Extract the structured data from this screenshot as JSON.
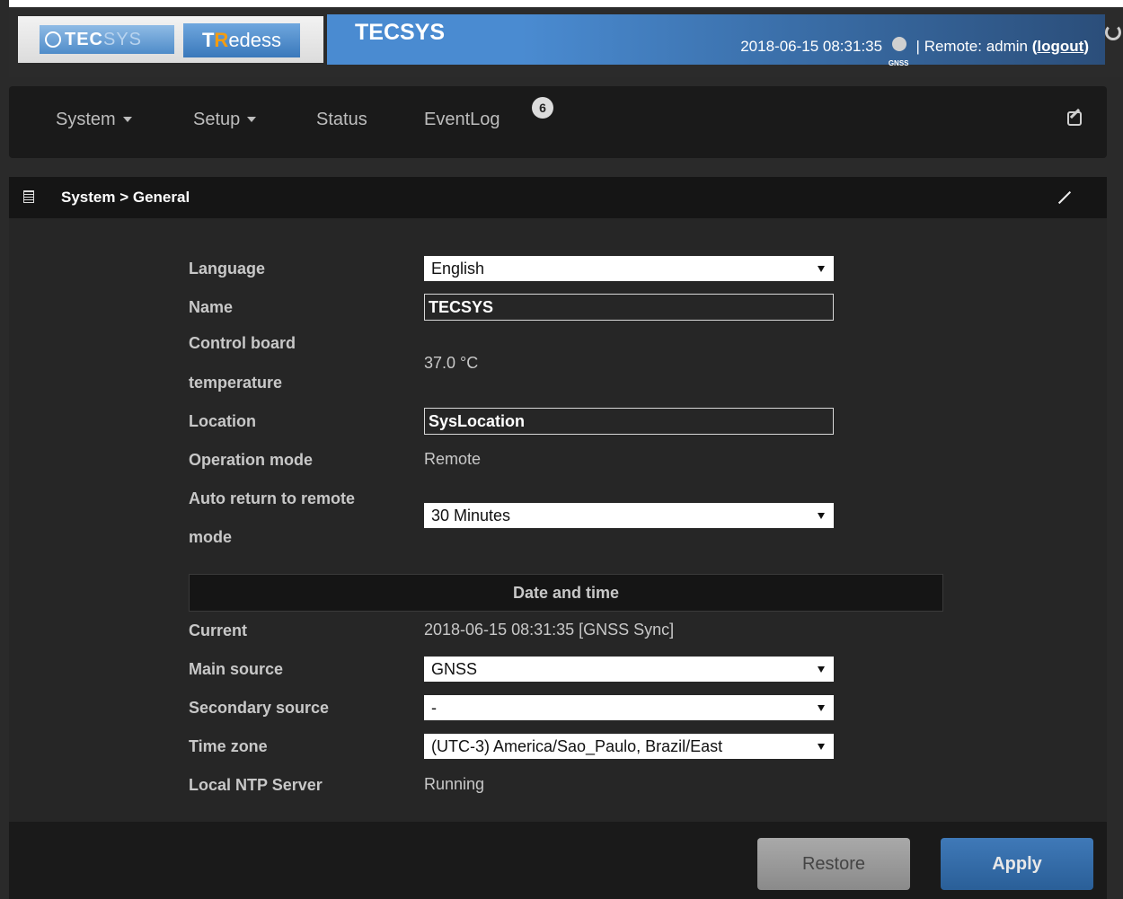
{
  "header": {
    "logo_tecsys_prefix": "TEC",
    "logo_tecsys_suffix": "SYS",
    "logo_redess_t": "T",
    "logo_redess_r": "R",
    "logo_redess_rest": "edess",
    "app_title": "TECSYS",
    "datetime": "2018-06-15 08:31:35",
    "gnss_label": "GNSS",
    "separator": "|",
    "remote_label": "Remote:",
    "user": "admin",
    "logout_open": "(",
    "logout_label": "logout",
    "logout_close": ")",
    "refresh_icon": "refresh-icon"
  },
  "nav": {
    "system": "System",
    "setup": "Setup",
    "status": "Status",
    "eventlog": "EventLog",
    "eventlog_badge": "6",
    "edit_icon": "edit-icon"
  },
  "panel": {
    "title": "System > General",
    "icon": "list-icon",
    "collapse_icon": "collapse-icon"
  },
  "form": {
    "language_label": "Language",
    "language_value": "English",
    "name_label": "Name",
    "name_value": "TECSYS",
    "temp_label_line1": "Control board",
    "temp_label_line2": "temperature",
    "temp_value": "37.0 °C",
    "location_label": "Location",
    "location_value": "SysLocation",
    "opmode_label": "Operation mode",
    "opmode_value": "Remote",
    "autoreturn_label_line1": "Auto return to remote",
    "autoreturn_label_line2": "mode",
    "autoreturn_value": "30 Minutes"
  },
  "datetime_section": {
    "title": "Date and time",
    "current_label": "Current",
    "current_value": "2018-06-15 08:31:35 [GNSS Sync]",
    "main_source_label": "Main source",
    "main_source_value": "GNSS",
    "secondary_source_label": "Secondary source",
    "secondary_source_value": "-",
    "timezone_label": "Time zone",
    "timezone_value": "(UTC-3) America/Sao_Paulo, Brazil/East",
    "ntp_label": "Local NTP Server",
    "ntp_value": "Running"
  },
  "footer": {
    "restore_label": "Restore",
    "apply_label": "Apply"
  },
  "colors": {
    "background": "#2a2a2a",
    "title_bar": "#4a8bd1",
    "apply": "#3a6ea8",
    "restore": "#9a9a9a"
  }
}
